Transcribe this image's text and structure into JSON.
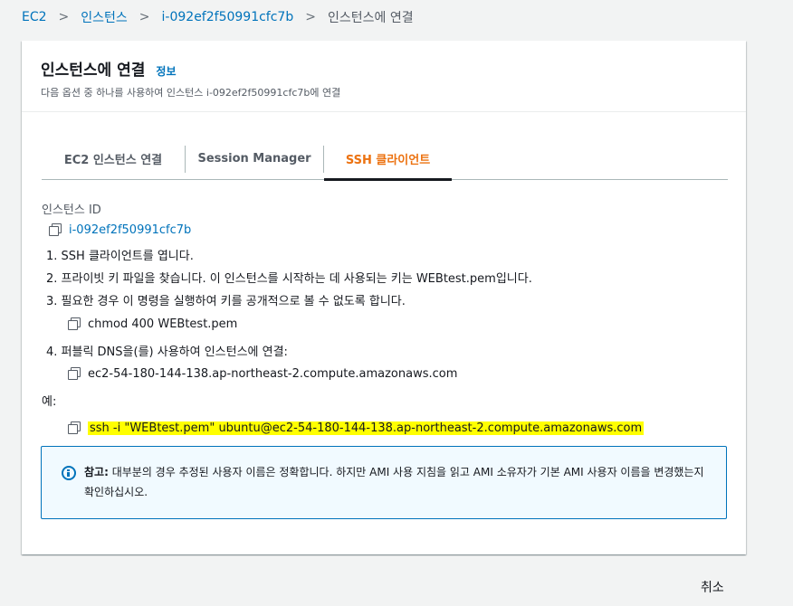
{
  "breadcrumb": {
    "items": [
      "EC2",
      "인스턴스",
      "i-092ef2f50991cfc7b",
      "인스턴스에 연결"
    ],
    "separator": ">"
  },
  "header": {
    "title": "인스턴스에 연결",
    "info_link": "정보",
    "subtitle": "다음 옵션 중 하나를 사용하여 인스턴스 i-092ef2f50991cfc7b에 연결"
  },
  "tabs": [
    {
      "label": "EC2 인스턴스 연결",
      "active": false
    },
    {
      "label": "Session Manager",
      "active": false
    },
    {
      "label": "SSH 클라이언트",
      "active": true
    }
  ],
  "content": {
    "instance_id_label": "인스턴스 ID",
    "instance_id": "i-092ef2f50991cfc7b",
    "steps": [
      "1. SSH 클라이언트를 엽니다.",
      "2. 프라이빗 키 파일을 찾습니다. 이 인스턴스를 시작하는 데 사용되는 키는 WEBtest.pem입니다.",
      "3. 필요한 경우 이 명령을 실행하여 키를 공개적으로 볼 수 없도록 합니다.",
      "4. 퍼블릭 DNS을(를) 사용하여 인스턴스에 연결:"
    ],
    "chmod_command": "chmod 400 WEBtest.pem",
    "public_dns": "ec2-54-180-144-138.ap-northeast-2.compute.amazonaws.com",
    "example_label": "예:",
    "ssh_command": "ssh -i \"WEBtest.pem\" ubuntu@ec2-54-180-144-138.ap-northeast-2.compute.amazonaws.com"
  },
  "alert": {
    "prefix": "참고:",
    "text": " 대부분의 경우 추정된 사용자 이름은 정확합니다. 하지만 AMI 사용 지침을 읽고 AMI 소유자가 기본 AMI 사용자 이름을 변경했는지 확인하십시오."
  },
  "footer": {
    "cancel_label": "취소"
  },
  "colors": {
    "link": "#0073bb",
    "active_tab": "#ec7211",
    "highlight": "#ffff00",
    "alert_border": "#0073bb"
  }
}
